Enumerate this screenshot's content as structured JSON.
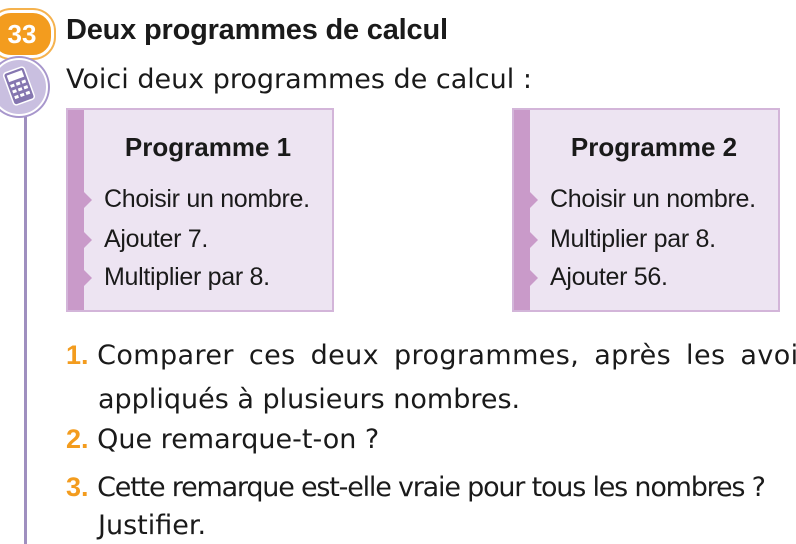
{
  "exercise": {
    "number": "33",
    "title": "Deux programmes de calcul",
    "intro": "Voici deux programmes de calcul :"
  },
  "programs": [
    {
      "title": "Programme 1",
      "steps": [
        "Choisir un nombre.",
        "Ajouter 7.",
        "Multiplier par 8."
      ]
    },
    {
      "title": "Programme 2",
      "steps": [
        "Choisir un nombre.",
        "Multiplier par 8.",
        "Ajouter 56."
      ]
    }
  ],
  "questions": [
    {
      "number": "1.",
      "line1": "Comparer ces deux programmes, après les avoir",
      "line2": "appliqués à plusieurs nombres."
    },
    {
      "number": "2.",
      "line1": "Que remarque-t-on ?"
    },
    {
      "number": "3.",
      "line1": "Cette remarque est-elle vraie pour tous les nombres ?",
      "line2": "Justifier."
    }
  ],
  "icons": {
    "calculator": "calculator-icon"
  },
  "colors": {
    "accent_orange": "#f39c1e",
    "box_fill": "#ede4f2",
    "box_strip": "#c99ac9",
    "rule": "#9f8fbf"
  }
}
